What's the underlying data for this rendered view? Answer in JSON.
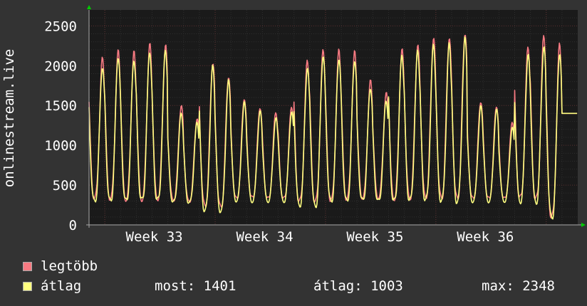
{
  "chart_data": {
    "type": "line",
    "ylabel": "onlinestream.live",
    "ylim": [
      0,
      2700
    ],
    "yticks": [
      0,
      500,
      1000,
      1500,
      2000,
      2500
    ],
    "xtick_labels": [
      "Week 33",
      "Week 34",
      "Week 35",
      "Week 36"
    ],
    "grid": true,
    "colors": {
      "max": "#f77a82",
      "avg": "#ffff80",
      "background": "#1a1a1a",
      "grid_major": "#5a3030",
      "grid_minor": "#2e2e2e"
    },
    "days": 31,
    "series": [
      {
        "name": "legtöbb",
        "daily_peak": [
          2080,
          2170,
          2160,
          2260,
          2250,
          1500,
          1340,
          2050,
          1880,
          1600,
          1480,
          1420,
          1480,
          2060,
          2180,
          2180,
          2160,
          1800,
          1650,
          2200,
          2260,
          2360,
          2370,
          2430,
          1560,
          1500,
          1300,
          2240,
          2370,
          2260,
          1401
        ],
        "daily_trough": [
          350,
          340,
          330,
          330,
          340,
          320,
          300,
          250,
          230,
          330,
          340,
          330,
          330,
          300,
          300,
          320,
          340,
          350,
          350,
          340,
          350,
          360,
          350,
          340,
          330,
          330,
          330,
          340,
          330,
          110,
          1401
        ]
      },
      {
        "name": "átlag",
        "daily_peak": [
          2000,
          2130,
          2090,
          2180,
          2200,
          1400,
          1280,
          1980,
          1800,
          1530,
          1420,
          1340,
          1420,
          1980,
          2140,
          2110,
          2090,
          1730,
          1570,
          2140,
          2190,
          2250,
          2260,
          2330,
          1480,
          1440,
          1220,
          2140,
          2250,
          2170,
          1401
        ],
        "daily_trough": [
          300,
          300,
          300,
          310,
          310,
          290,
          280,
          190,
          180,
          310,
          300,
          300,
          300,
          250,
          240,
          300,
          300,
          310,
          300,
          300,
          310,
          320,
          310,
          300,
          300,
          300,
          300,
          300,
          290,
          100,
          1401
        ]
      }
    ]
  },
  "legend": [
    {
      "label": "legtöbb",
      "color": "#f77a82"
    },
    {
      "label": "átlag",
      "color": "#ffff80"
    }
  ],
  "stats": {
    "most": "most: 1401",
    "atlag": "átlag: 1003",
    "max": "max: 2348"
  }
}
